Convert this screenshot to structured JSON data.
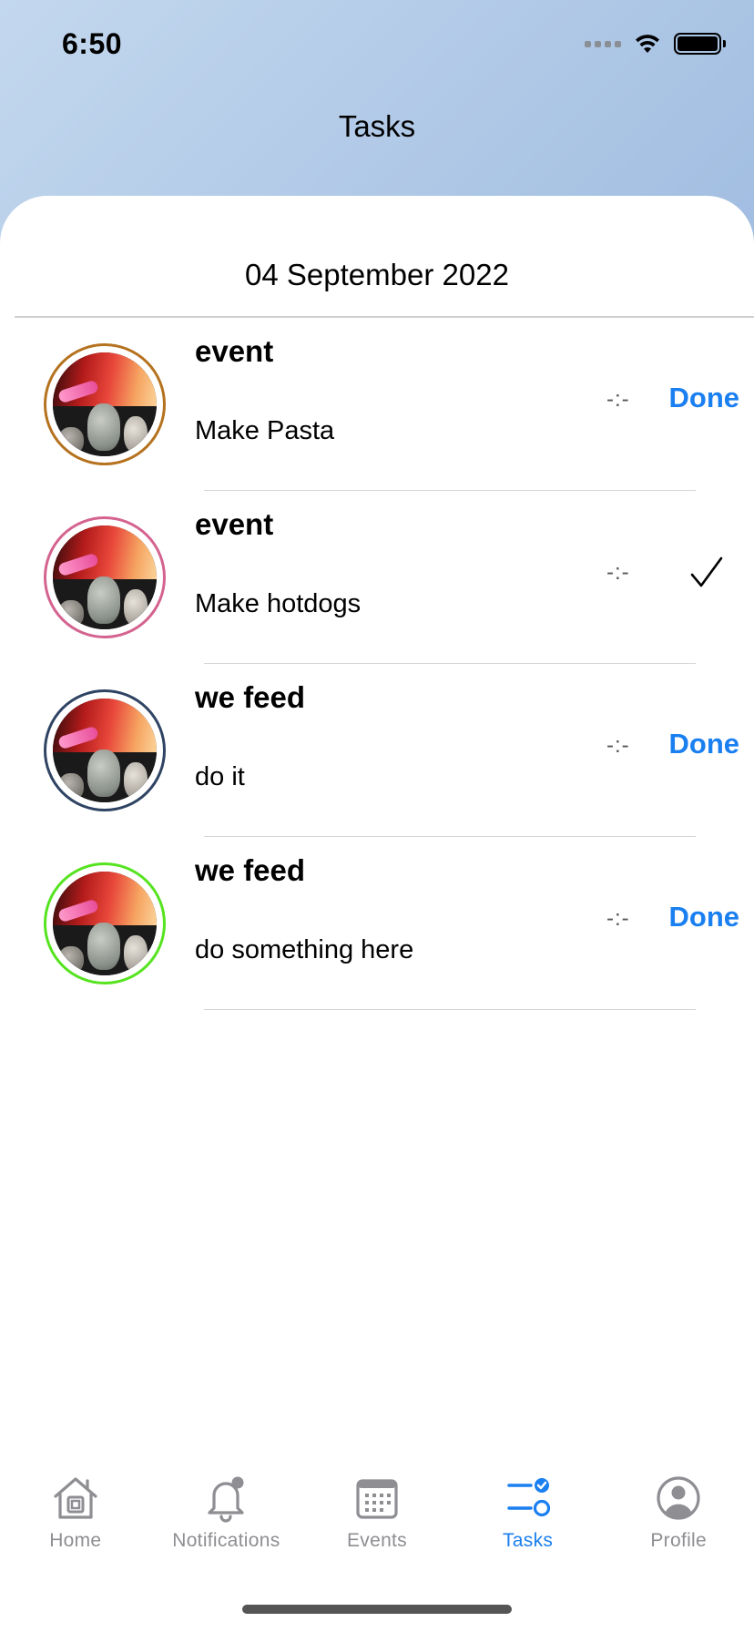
{
  "status_bar": {
    "time": "6:50"
  },
  "nav": {
    "title": "Tasks"
  },
  "date_header": "04 September 2022",
  "tasks": [
    {
      "title": "event",
      "description": "Make Pasta",
      "time": "-:-",
      "action": "Done",
      "completed": false,
      "ring_color": "#b5721f"
    },
    {
      "title": "event",
      "description": "Make hotdogs",
      "time": "-:-",
      "action": "",
      "completed": true,
      "ring_color": "#d4638f"
    },
    {
      "title": "we feed",
      "description": "do it",
      "time": "-:-",
      "action": "Done",
      "completed": false,
      "ring_color": "#2f4363"
    },
    {
      "title": "we feed",
      "description": "do something here",
      "time": "-:-",
      "action": "Done",
      "completed": false,
      "ring_color": "#56e320"
    }
  ],
  "tab_bar": {
    "tabs": [
      {
        "label": "Home",
        "icon": "home-icon",
        "active": false
      },
      {
        "label": "Notifications",
        "icon": "bell-icon",
        "active": false
      },
      {
        "label": "Events",
        "icon": "calendar-icon",
        "active": false
      },
      {
        "label": "Tasks",
        "icon": "tasks-icon",
        "active": true
      },
      {
        "label": "Profile",
        "icon": "profile-icon",
        "active": false
      }
    ]
  },
  "colors": {
    "accent": "#1a7ff0",
    "inactive": "#8e8e93"
  }
}
